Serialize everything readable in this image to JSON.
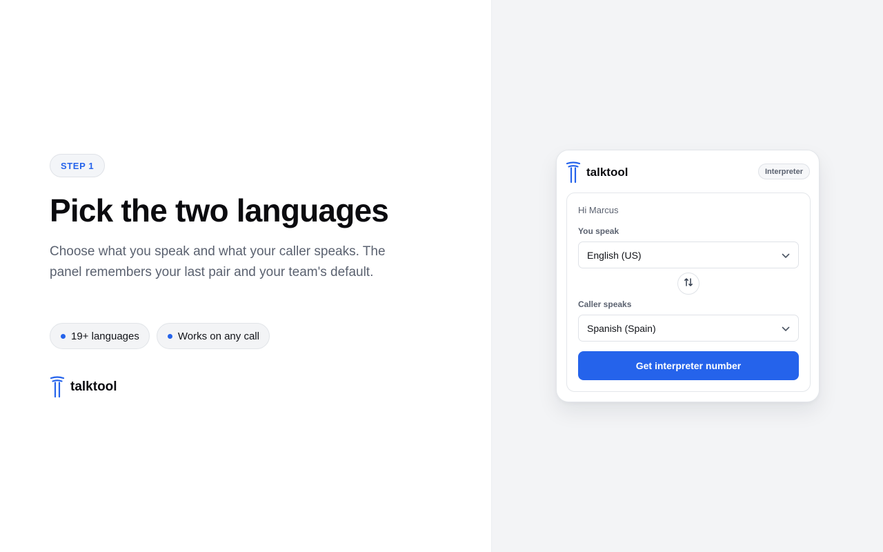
{
  "intro": {
    "step_label": "STEP 1",
    "headline": "Pick the two languages",
    "subcopy": "Choose what you speak and what your caller speaks. The panel remembers your last pair and your team's default.",
    "chips": [
      "19+ languages",
      "Works on any call"
    ],
    "brand_name": "talktool"
  },
  "panel": {
    "brand_name": "talktool",
    "role_badge": "Interpreter",
    "greeting": "Hi Marcus",
    "you_speak_label": "You speak",
    "you_speak_value": "English (US)",
    "caller_speaks_label": "Caller speaks",
    "caller_speaks_value": "Spanish (Spain)",
    "cta_label": "Get interpreter number"
  },
  "icons": {
    "logo": "talktool-logo-icon",
    "select_chevron": "chevron-down-icon",
    "swap": "swap-vertical-icon"
  },
  "colors": {
    "accent": "#2563eb",
    "panel_background": "#f3f4f6",
    "headline": "#0b0b0f",
    "muted_text": "#5b6270"
  }
}
